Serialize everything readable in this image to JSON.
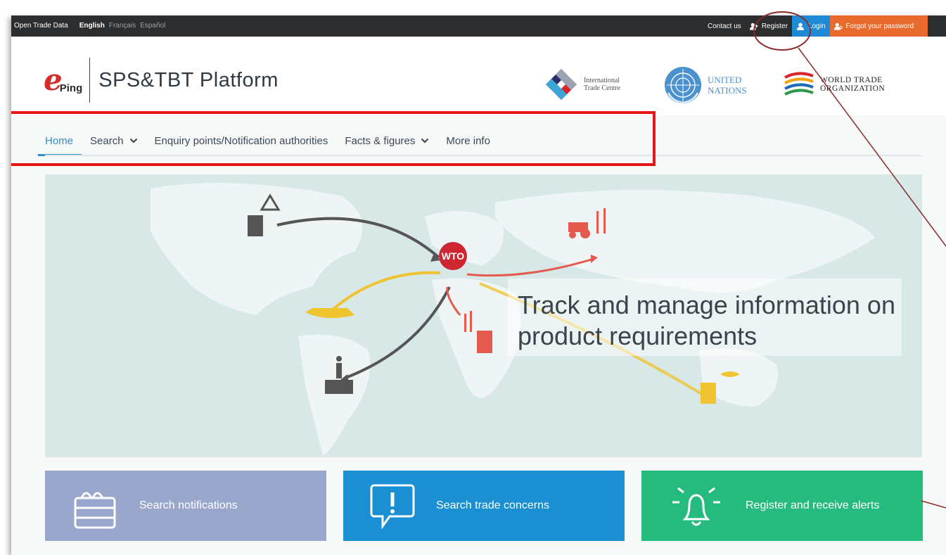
{
  "topbar": {
    "open_trade_data": "Open Trade Data",
    "languages": [
      "English",
      "Français",
      "Español"
    ],
    "contact": "Contact us",
    "register": "Register",
    "login": "Login",
    "forgot": "Forgot your password"
  },
  "header": {
    "logo_e": "e",
    "logo_ping": "Ping",
    "platform_title": "SPS&TBT Platform",
    "itc": "International Trade Centre",
    "un": "UNITED NATIONS",
    "wto": "WORLD TRADE ORGANIZATION"
  },
  "nav": {
    "home": "Home",
    "search": "Search",
    "enquiry": "Enquiry points/Notification authorities",
    "facts": "Facts & figures",
    "more": "More info"
  },
  "hero": {
    "wto_badge": "WTO",
    "headline_line1": "Track and manage information on",
    "headline_line2": "product requirements"
  },
  "cards": {
    "notifications": "Search notifications",
    "trade_concerns": "Search trade concerns",
    "alerts": "Register and receive alerts"
  },
  "colors": {
    "brand_red": "#d42b2b",
    "nav_active": "#2f8fc9",
    "login": "#1e8ad6",
    "forgot": "#e86a2c",
    "card_notifications": "#9aa7cc",
    "card_concerns": "#1a8fd1",
    "card_alerts": "#26bb7e",
    "highlight": "#e41616"
  }
}
